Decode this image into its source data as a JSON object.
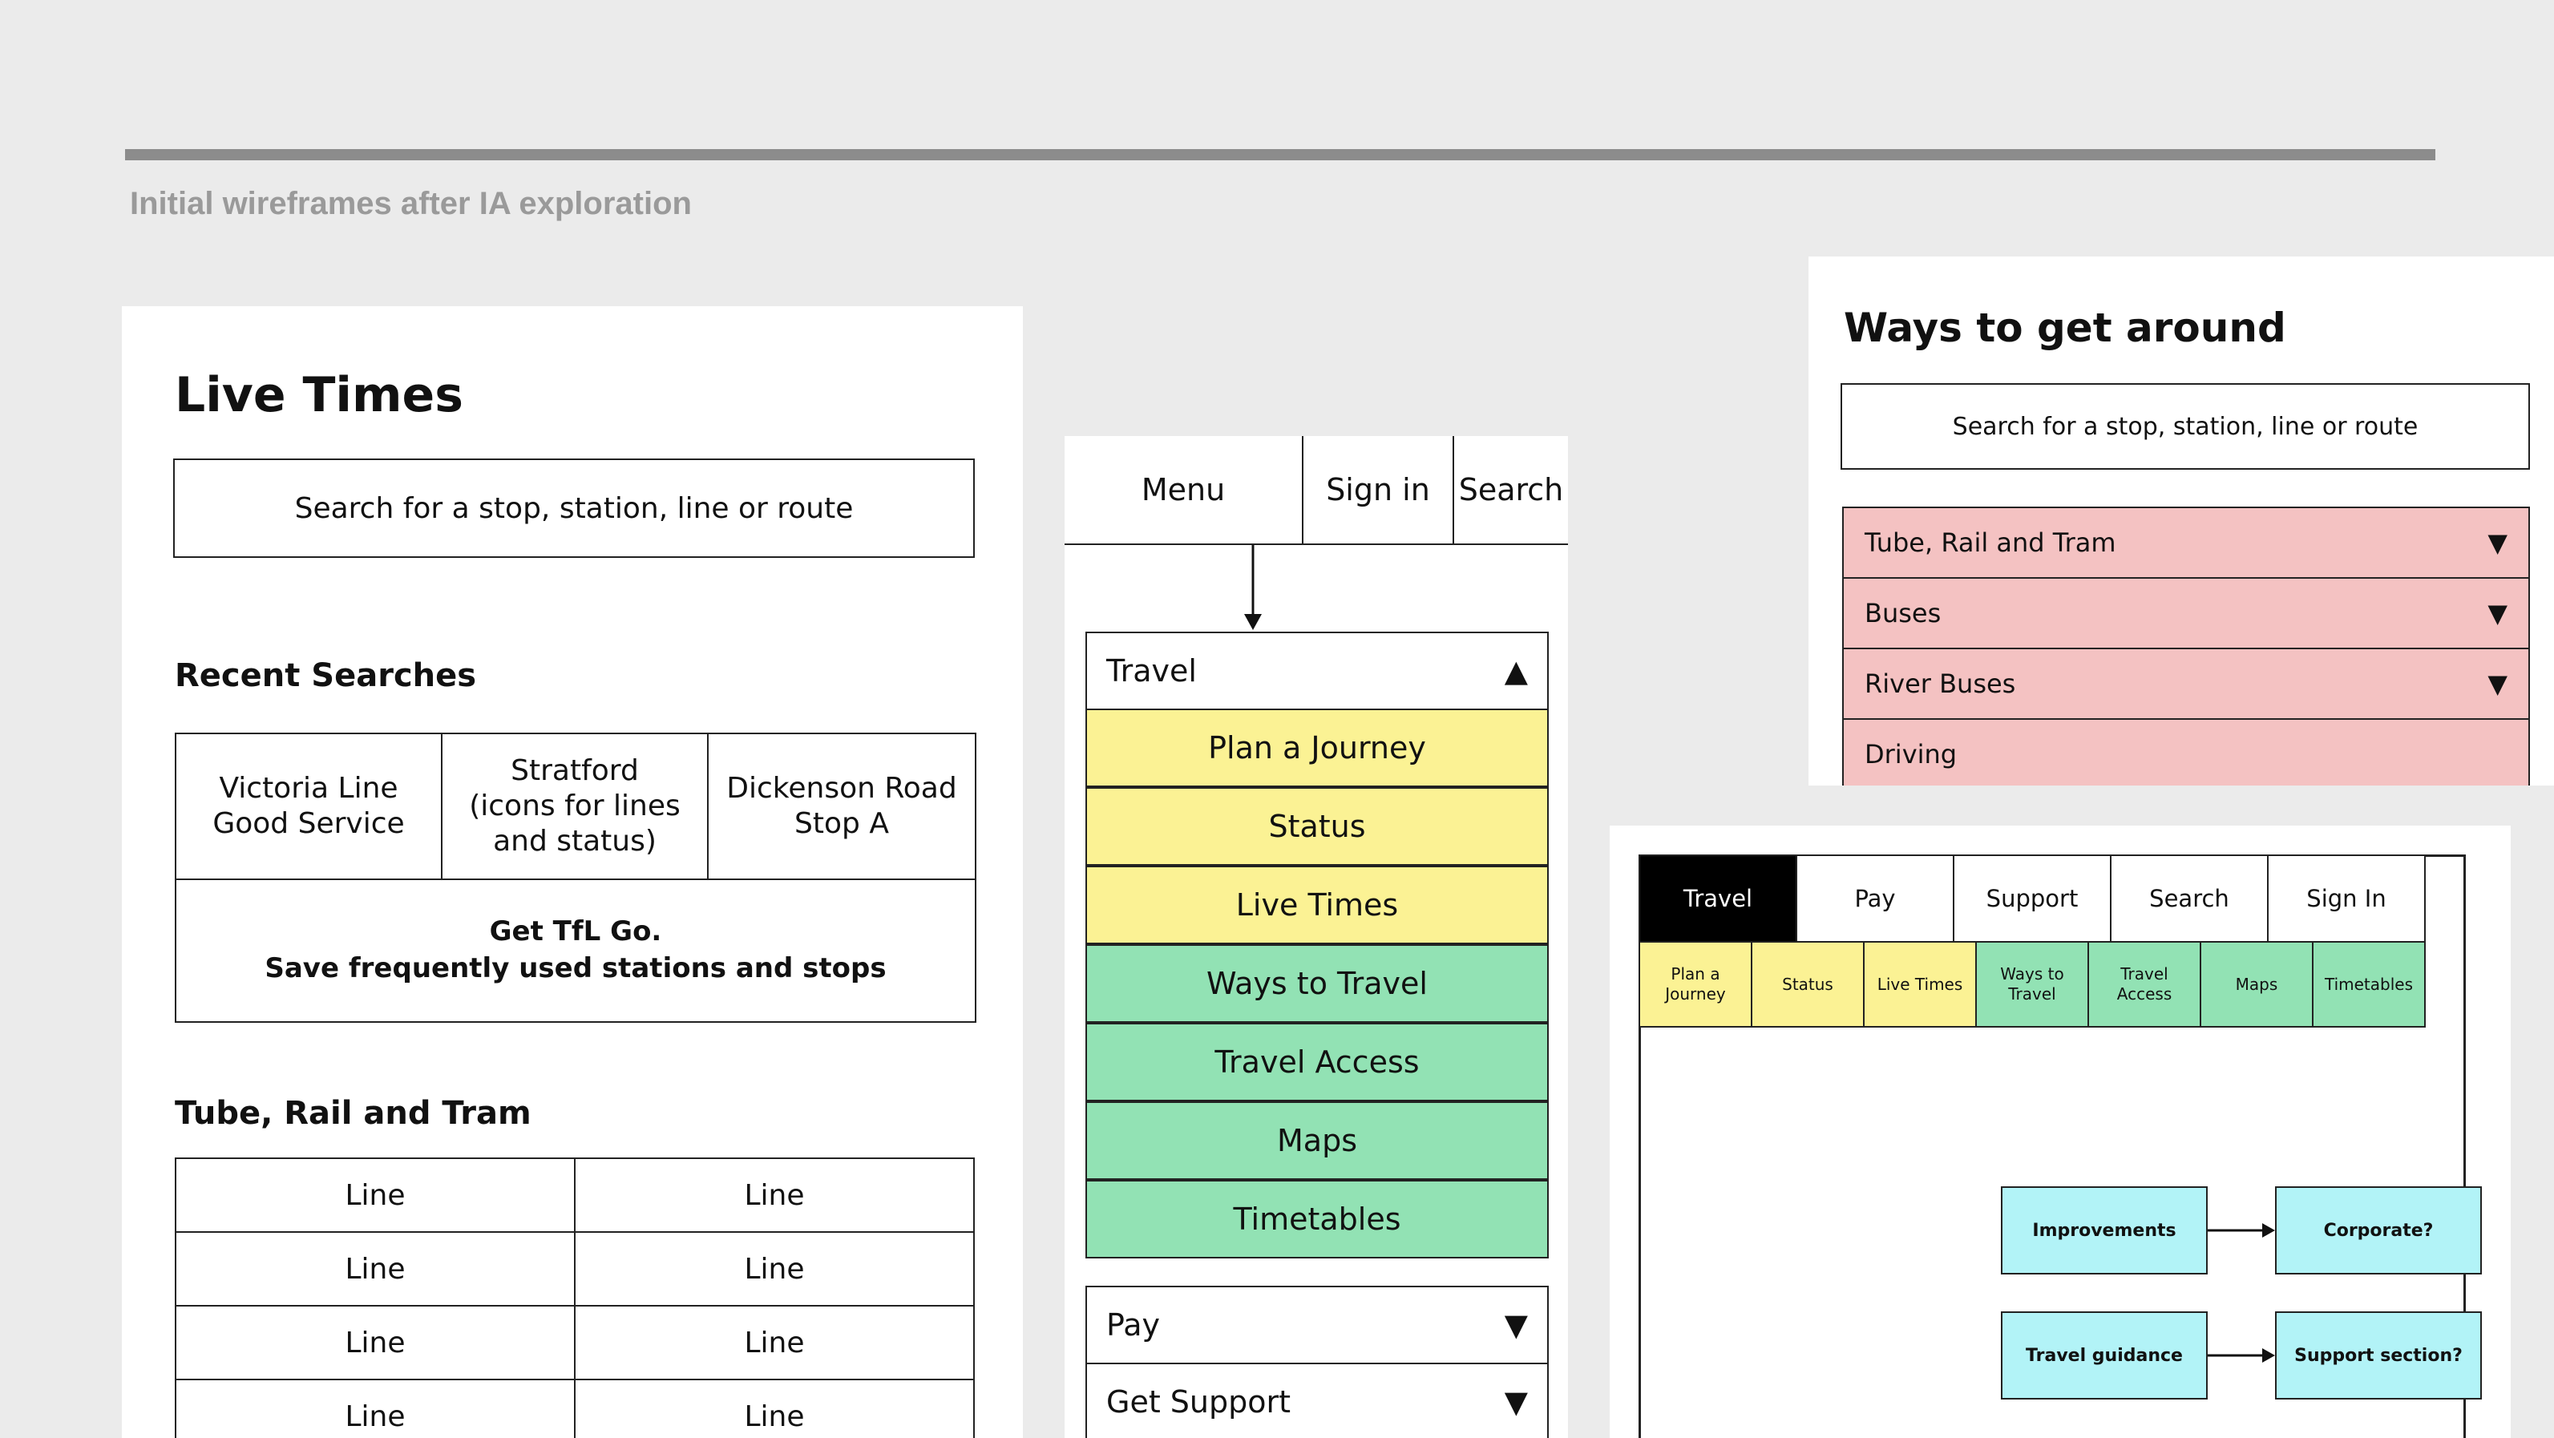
{
  "caption": "Initial wireframes after IA exploration",
  "live_times": {
    "title": "Live Times",
    "search_placeholder": "Search for a stop, station, line or route",
    "recent_heading": "Recent Searches",
    "recent": [
      [
        "Victoria Line",
        "Good Service"
      ],
      [
        "Stratford",
        "(icons for lines",
        "and status)"
      ],
      [
        "Dickenson Road",
        "Stop A"
      ]
    ],
    "promo_line1": "Get TfL Go.",
    "promo_line2": "Save frequently used stations and stops",
    "tube_heading": "Tube, Rail and Tram",
    "line_label": "Line"
  },
  "mobile_menu": {
    "tabs": [
      "Menu",
      "Sign in",
      "Search"
    ],
    "travel_label": "Travel",
    "travel_items_yellow": [
      "Plan a Journey",
      "Status",
      "Live Times"
    ],
    "travel_items_green": [
      "Ways to Travel",
      "Travel Access",
      "Maps",
      "Timetables"
    ],
    "pay_label": "Pay",
    "support_label": "Get Support",
    "arrow_up": "▲",
    "arrow_down": "▼"
  },
  "ways": {
    "title": "Ways to get around",
    "search_placeholder": "Search for a stop, station, line or route",
    "items": [
      "Tube, Rail and Tram",
      "Buses",
      "River Buses",
      "Driving"
    ],
    "arrow_down": "▼"
  },
  "desktop": {
    "tabs": [
      "Travel",
      "Pay",
      "Support",
      "Search",
      "Sign In"
    ],
    "subtabs_yellow": [
      [
        "Plan a",
        "Journey"
      ],
      [
        "Status"
      ],
      [
        "Live Times"
      ]
    ],
    "subtabs_green": [
      [
        "Ways to",
        "Travel"
      ],
      [
        "Travel",
        "Access"
      ],
      [
        "Maps"
      ],
      [
        "Timetables"
      ]
    ],
    "nodes": [
      "Improvements",
      "Corporate?",
      "Travel guidance",
      "Support section?"
    ]
  },
  "colors": {
    "yellow": "#fbf294",
    "green": "#92e2b4",
    "pink": "#f4c2c2",
    "cyan": "#b2f3f7"
  }
}
